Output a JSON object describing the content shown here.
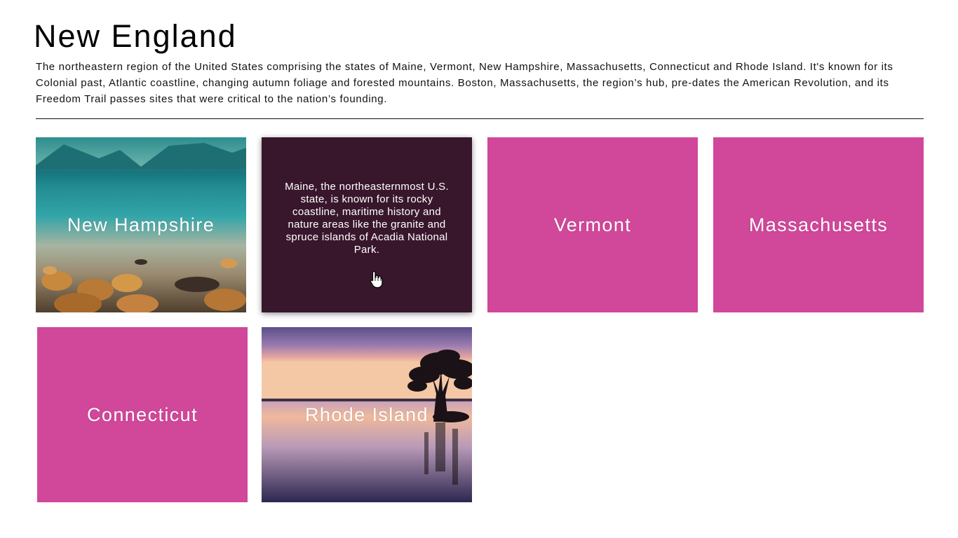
{
  "page": {
    "title": "New England",
    "intro": "The northeastern region of the United States comprising the states of Maine, Vermont, New Hampshire, Massachusetts, Connecticut and Rhode Island. It's known for its Colonial past, Atlantic coastline, changing autumn foliage and forested mountains. Boston, Massachusetts, the region’s hub, pre-dates the American Revolution, and its Freedom Trail passes sites that were critical to the nation’s founding."
  },
  "tiles": [
    {
      "label": "New Hampshire",
      "style": "photo-lake"
    },
    {
      "label": "Maine",
      "description": "Maine, the northeasternmost U.S. state, is known for its rocky coastline, maritime history and nature areas like the granite and spruce islands of Acadia National Park.",
      "style": "hover-description"
    },
    {
      "label": "Vermont",
      "style": "solid"
    },
    {
      "label": "Massachusetts",
      "style": "solid"
    },
    {
      "label": "Connecticut",
      "style": "solid"
    },
    {
      "label": "Rhode Island",
      "style": "photo-sunset-tree"
    }
  ],
  "colors": {
    "tile_pink": "#d1479a",
    "tile_hover_dark": "#38172c",
    "text_dark": "#111111",
    "tile_text": "#ffffff"
  },
  "icons": {
    "cursor": "hand-pointer-icon"
  }
}
